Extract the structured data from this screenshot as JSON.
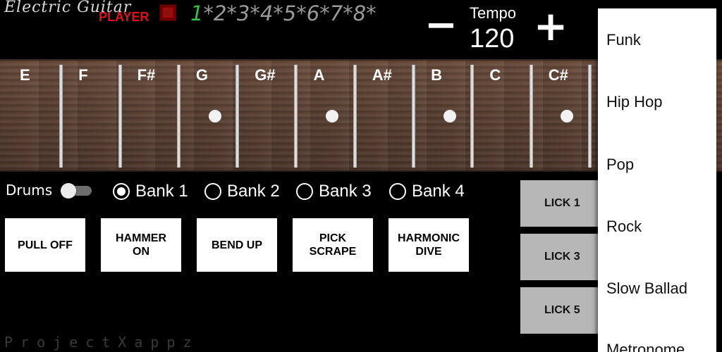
{
  "header": {
    "title": "Electric Guitar",
    "subtitle": "PLAYER",
    "pattern_active": "1",
    "pattern_rest": "*2*3*4*5*6*7*8*",
    "tempo_minus": "−",
    "tempo_label": "Tempo",
    "tempo_value": "120",
    "tempo_plus": "+",
    "stop_icon": "stop-icon",
    "colors": {
      "subtitle": "#e0101c",
      "pattern_active": "#2ec04a"
    }
  },
  "fretboard": {
    "notes": [
      "E",
      "F",
      "F#",
      "G",
      "G#",
      "A",
      "A#",
      "B",
      "C",
      "C#"
    ],
    "dots_on_frets": [
      "G",
      "A",
      "B",
      "C#"
    ]
  },
  "controls": {
    "drums_label": "Drums",
    "drums_on": false,
    "banks": [
      {
        "label": "Bank 1",
        "checked": true
      },
      {
        "label": "Bank 2",
        "checked": false
      },
      {
        "label": "Bank 3",
        "checked": false
      },
      {
        "label": "Bank 4",
        "checked": false
      }
    ]
  },
  "techniques": [
    {
      "line1": "PULL OFF",
      "line2": ""
    },
    {
      "line1": "HAMMER",
      "line2": "ON"
    },
    {
      "line1": "BEND UP",
      "line2": ""
    },
    {
      "line1": "PICK",
      "line2": "SCRAPE"
    },
    {
      "line1": "HARMONIC",
      "line2": "DIVE"
    }
  ],
  "licks": [
    "LICK 1",
    "LICK 3",
    "LICK 5"
  ],
  "footer": "ProjectXappz",
  "style_menu": [
    "Funk",
    "Hip Hop",
    "Pop",
    "Rock",
    "Slow Ballad",
    "Metronome"
  ]
}
